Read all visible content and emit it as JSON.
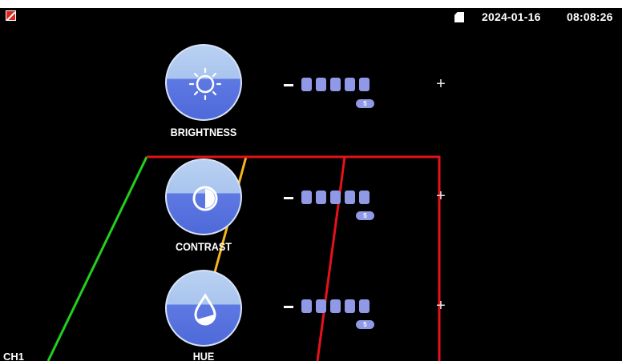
{
  "status_bar": {
    "date": "2024-01-16",
    "time": "08:08:26",
    "icons": [
      "recording-disabled-icon",
      "sd-card-icon"
    ]
  },
  "settings": [
    {
      "id": "brightness",
      "label": "BRIGHTNESS",
      "icon": "sun-icon",
      "level": 5,
      "value_badge": "5",
      "minus": "−",
      "plus": "+"
    },
    {
      "id": "contrast",
      "label": "CONTRAST",
      "icon": "contrast-icon",
      "level": 5,
      "value_badge": "5",
      "minus": "−",
      "plus": "+"
    },
    {
      "id": "hue",
      "label": "HUE",
      "icon": "droplet-icon",
      "level": 5,
      "value_badge": "5",
      "minus": "−",
      "plus": "+"
    }
  ],
  "channel": {
    "label": "CH1"
  },
  "colors": {
    "guide_green": "#22d01d",
    "guide_yellow": "#f5b51c",
    "guide_red": "#e5121a",
    "slider_segment": "#8f99e6",
    "knob_top": "#b9d1f2",
    "knob_bottom": "#5571df"
  }
}
